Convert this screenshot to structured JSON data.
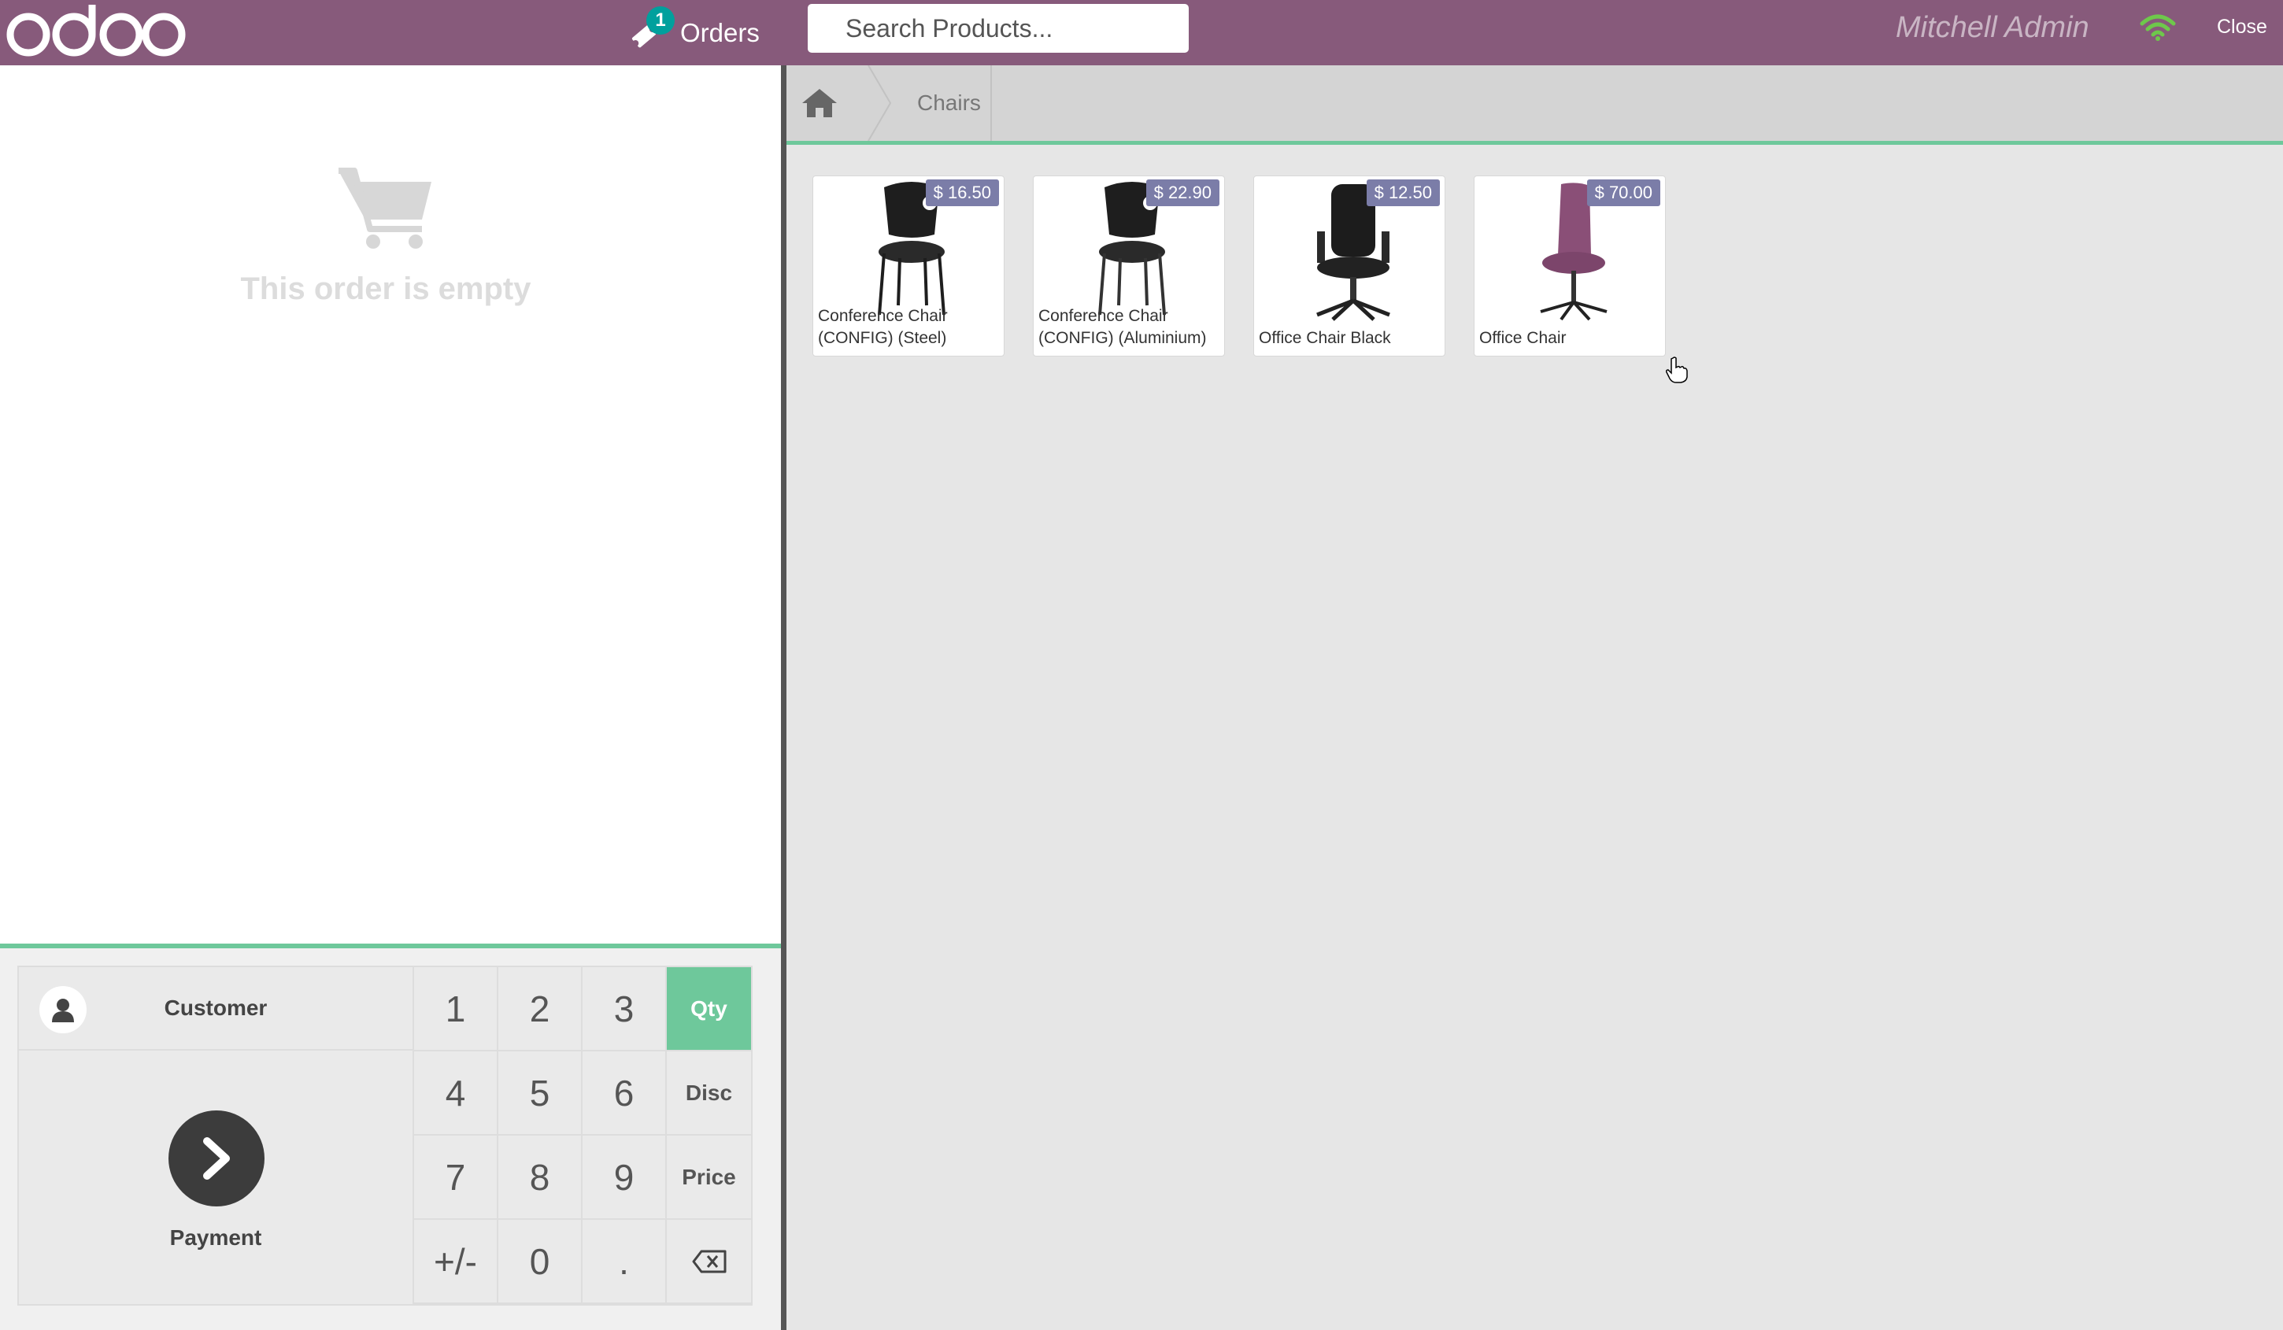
{
  "header": {
    "logo_text": "odoo",
    "orders_label": "Orders",
    "orders_count": "1",
    "search_placeholder": "Search Products...",
    "search_value": "",
    "user_name": "Mitchell Admin",
    "close_label": "Close"
  },
  "order": {
    "empty_message": "This order is empty"
  },
  "pad": {
    "customer_label": "Customer",
    "payment_label": "Payment",
    "keys": [
      "1",
      "2",
      "3",
      "Qty",
      "4",
      "5",
      "6",
      "Disc",
      "7",
      "8",
      "9",
      "Price",
      "+/-",
      "0",
      ".",
      "⌫"
    ],
    "active_mode": "Qty"
  },
  "breadcrumbs": {
    "category": "Chairs"
  },
  "products": [
    {
      "name": "Conference Chair (CONFIG) (Steel)",
      "price": "$ 16.50"
    },
    {
      "name": "Conference Chair (CONFIG) (Aluminium)",
      "price": "$ 22.90"
    },
    {
      "name": "Office Chair Black",
      "price": "$ 12.50"
    },
    {
      "name": "Office Chair",
      "price": "$ 70.00"
    }
  ],
  "colors": {
    "brand": "#875a7b",
    "accent": "#6ec89b",
    "badge": "#00a09d",
    "price_tag": "#7b7da8",
    "wifi": "#6ec84b"
  },
  "icons": [
    "odoo-logo",
    "ticket-icon",
    "search-icon",
    "close-x-icon",
    "wifi-icon",
    "cart-icon",
    "user-icon",
    "chevron-right-icon",
    "home-icon",
    "backspace-icon"
  ]
}
